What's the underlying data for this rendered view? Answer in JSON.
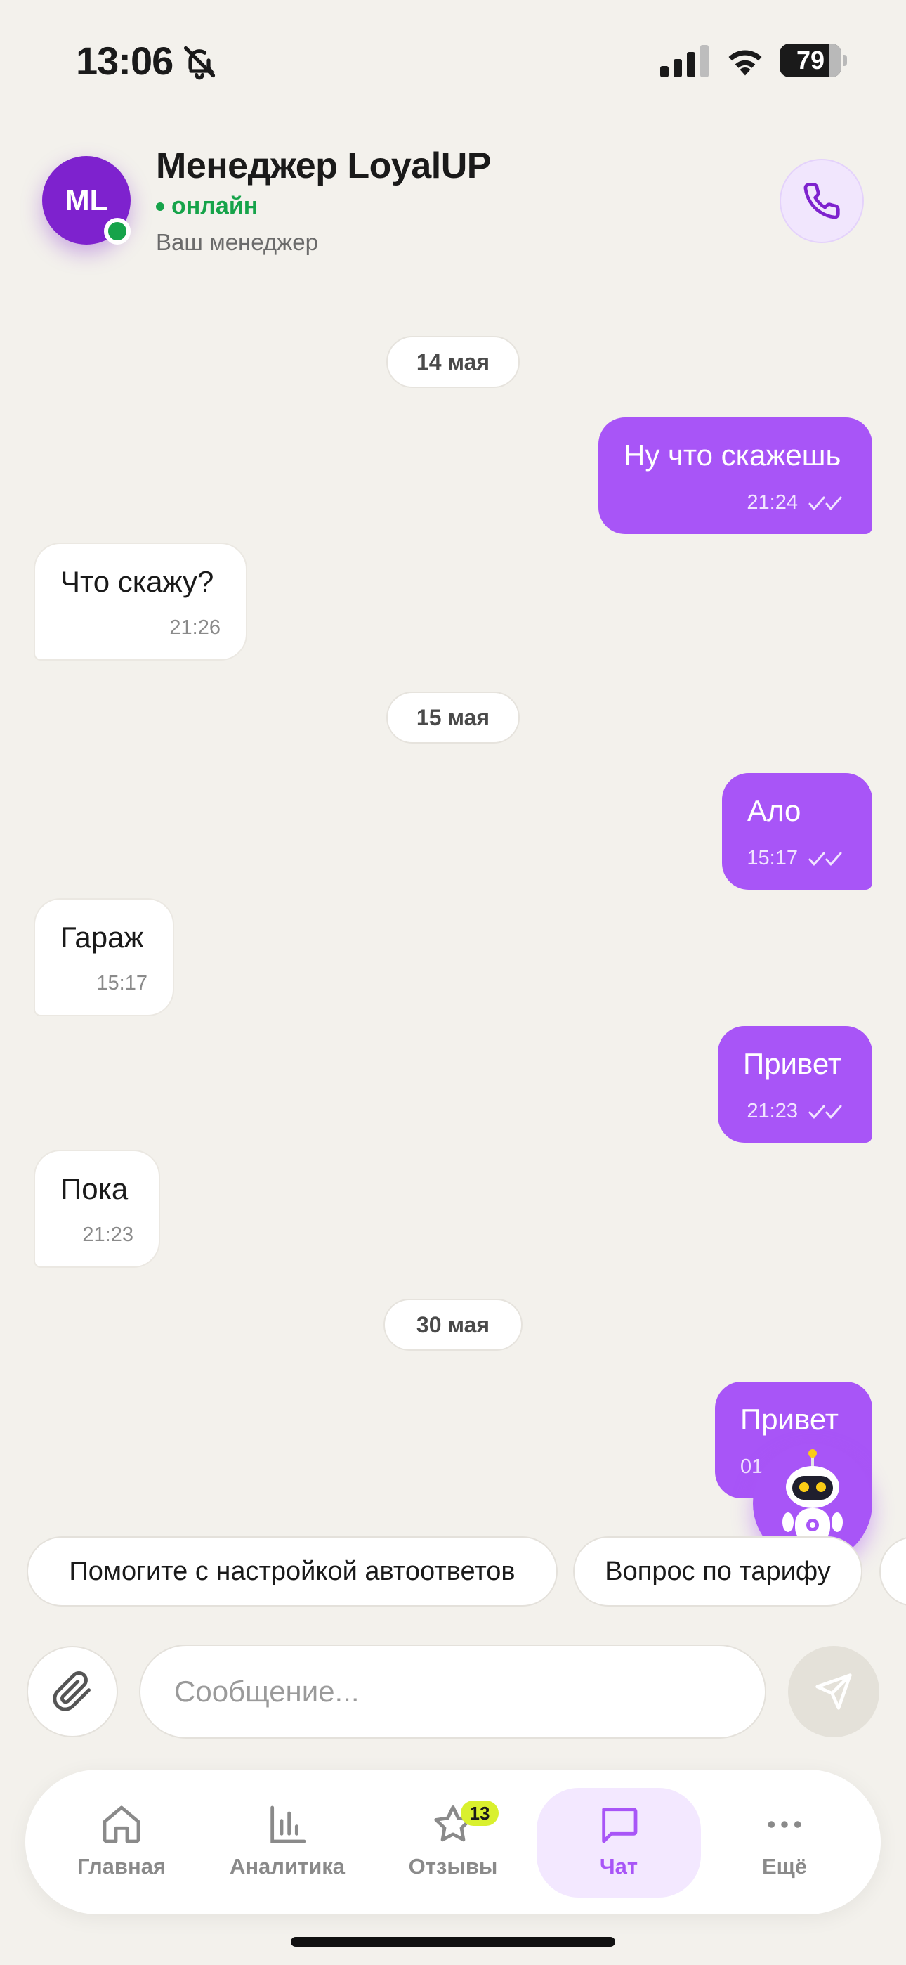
{
  "status_bar": {
    "time": "13:06",
    "battery": "79",
    "battery_fraction": 0.79
  },
  "header": {
    "avatar_initials": "ML",
    "name": "Менеджер LoyalUP",
    "status": "онлайн",
    "subtitle": "Ваш менеджер"
  },
  "chat": {
    "dates": [
      "14 мая",
      "15 мая",
      "30 мая"
    ],
    "messages": [
      {
        "direction": "out",
        "text": "Ну что скажешь",
        "time": "21:24"
      },
      {
        "direction": "in",
        "text": "Что скажу?",
        "time": "21:26"
      },
      {
        "direction": "out",
        "text": "Ало",
        "time": "15:17"
      },
      {
        "direction": "in",
        "text": "Гараж",
        "time": "15:17"
      },
      {
        "direction": "out",
        "text": "Привет",
        "time": "21:23"
      },
      {
        "direction": "in",
        "text": "Пока",
        "time": "21:23"
      },
      {
        "direction": "out",
        "text": "Привет",
        "time": "01"
      }
    ]
  },
  "quick_replies": [
    "Помогите с настройкой автоответов",
    "Вопрос по тарифу"
  ],
  "input": {
    "placeholder": "Сообщение..."
  },
  "nav": {
    "items": [
      {
        "label": "Главная",
        "icon": "home-icon"
      },
      {
        "label": "Аналитика",
        "icon": "analytics-icon"
      },
      {
        "label": "Отзывы",
        "icon": "star-icon",
        "badge": "13"
      },
      {
        "label": "Чат",
        "icon": "chat-icon",
        "active": true
      },
      {
        "label": "Ещё",
        "icon": "more-icon"
      }
    ]
  },
  "colors": {
    "accent": "#a855f7",
    "online": "#16a34a",
    "avatar": "#7e22ce",
    "badge": "#d9f02e",
    "background": "#f3f1ec"
  }
}
